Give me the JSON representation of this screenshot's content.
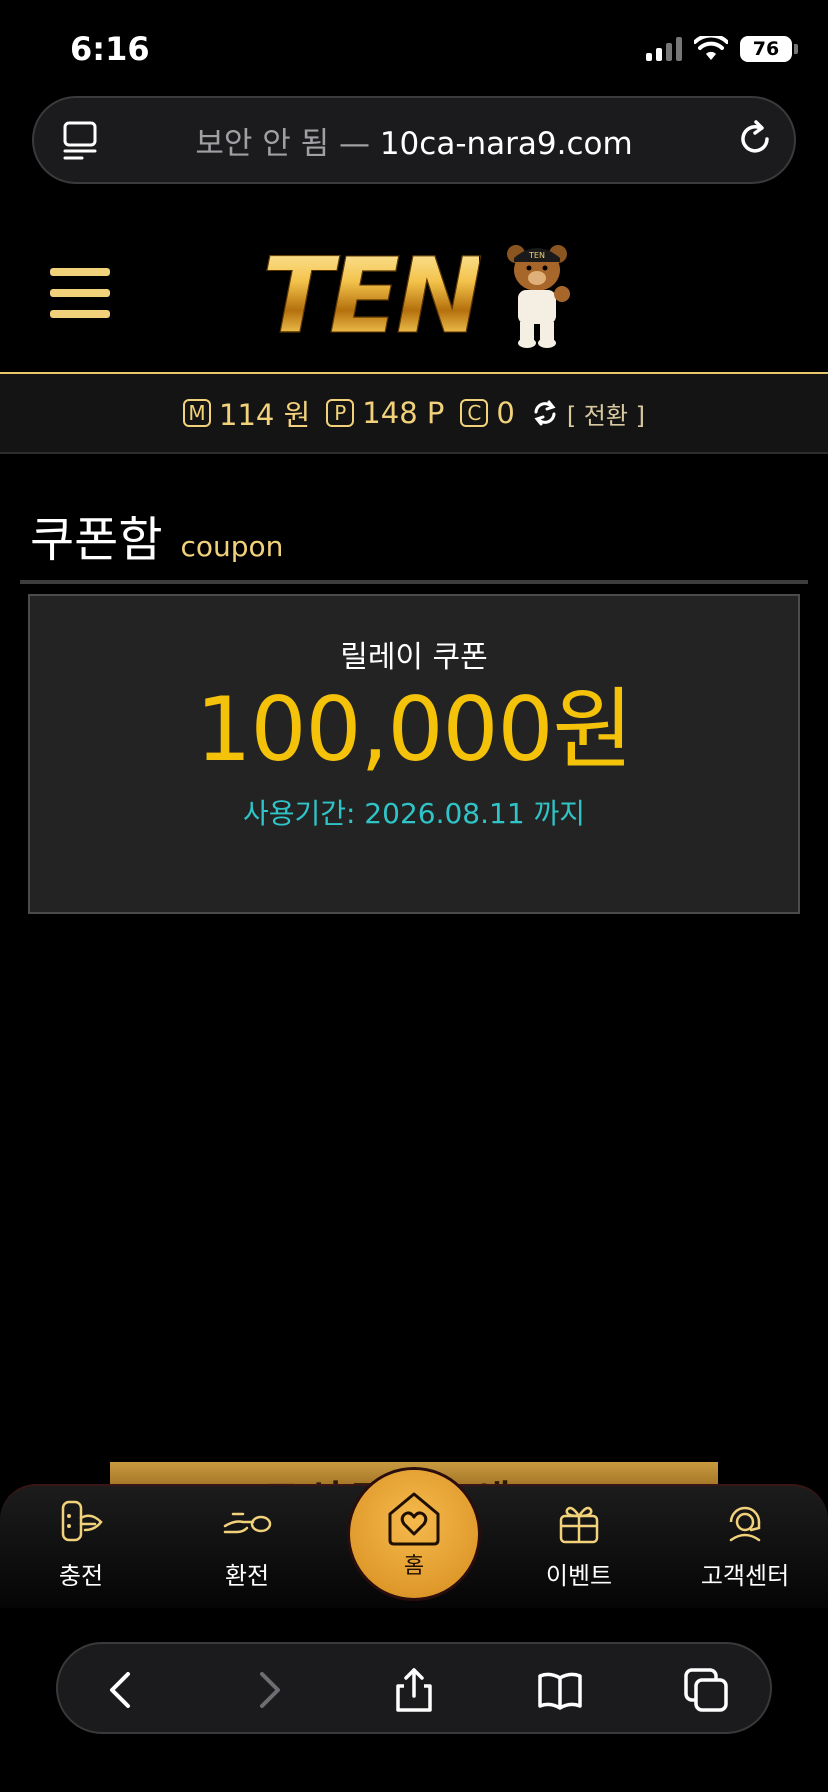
{
  "status_bar": {
    "time": "6:16",
    "battery": "76"
  },
  "browser": {
    "insecure_label": "보안 안 됨 —",
    "domain": "10ca-nara9.com"
  },
  "site": {
    "logo_text": "TEN",
    "mascot_hat_text": "TEN"
  },
  "balance": {
    "money_icon": "M",
    "money_value": "114 원",
    "point_icon": "P",
    "point_value": "148 P",
    "coin_icon": "C",
    "coin_value": "0",
    "switch_label": "[ 전환 ]"
  },
  "page": {
    "title": "쿠폰함",
    "subtitle": "coupon"
  },
  "coupon": {
    "name": "릴레이 쿠폰",
    "amount": "100,000원",
    "period": "사용기간: 2026.08.11 까지"
  },
  "banner": {
    "partial_text": "교신도 개 애!!"
  },
  "bottom_nav": {
    "items": [
      {
        "label": "충전",
        "icon": "deposit-icon"
      },
      {
        "label": "환전",
        "icon": "withdraw-icon"
      },
      {
        "label": "홈",
        "icon": "home-heart-icon"
      },
      {
        "label": "이벤트",
        "icon": "gift-icon"
      },
      {
        "label": "고객센터",
        "icon": "support-headset-icon"
      }
    ]
  },
  "colors": {
    "gold": "#f1d27a",
    "amount_yellow": "#f5c20a",
    "period_cyan": "#2fc4c7",
    "home_orange": "#e09a2c"
  }
}
